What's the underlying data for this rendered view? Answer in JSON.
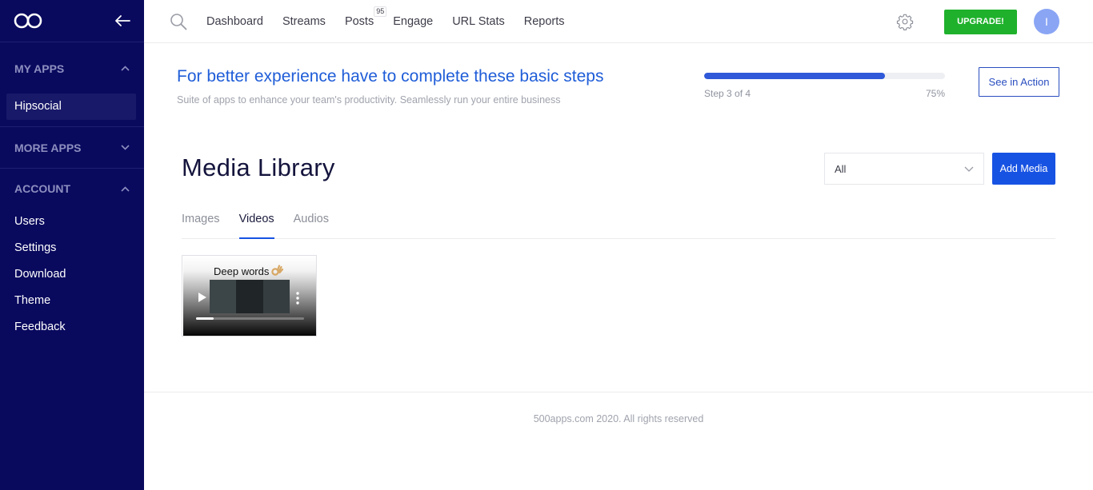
{
  "sidebar": {
    "logo_icon": "infinity-logo-icon",
    "back_icon": "arrow-left-icon",
    "sections": {
      "my_apps": {
        "label": "MY APPS",
        "chevron": "chevron-up-icon",
        "items": [
          "Hipsocial"
        ]
      },
      "more_apps": {
        "label": "MORE APPS",
        "chevron": "chevron-down-icon"
      },
      "account": {
        "label": "ACCOUNT",
        "chevron": "chevron-up-icon",
        "items": [
          "Users",
          "Settings",
          "Download",
          "Theme",
          "Feedback"
        ]
      }
    },
    "colors": {
      "background": "#09095e",
      "active_item": "#19196a"
    }
  },
  "topnav": {
    "links": [
      "Dashboard",
      "Streams",
      "Posts",
      "Engage",
      "URL Stats",
      "Reports"
    ],
    "posts_badge": "95",
    "upgrade_label": "UPGRADE!",
    "avatar_initial": "I",
    "colors": {
      "upgrade": "#1fb12c",
      "avatar": "#8aa5f4"
    }
  },
  "banner": {
    "title": "For better experience have to complete these basic steps",
    "subtitle": "Suite of apps to enhance your team's productivity. Seamlessly run your entire business",
    "step_text": "Step 3 of 4",
    "progress_percent_label": "75%",
    "progress_value": 0.75,
    "see_action_label": "See in Action",
    "accent_color": "#1f5dd8"
  },
  "library": {
    "title": "Media Library",
    "filter": {
      "selected": "All"
    },
    "add_media_label": "Add Media",
    "tabs": [
      "Images",
      "Videos",
      "Audios"
    ],
    "active_tab": "Videos",
    "videos": [
      {
        "caption": "Deep words",
        "caption_emoji": "ok-hand-icon"
      }
    ],
    "colors": {
      "primary": "#1753e3"
    }
  },
  "footer": {
    "text": "500apps.com 2020. All rights reserved"
  }
}
